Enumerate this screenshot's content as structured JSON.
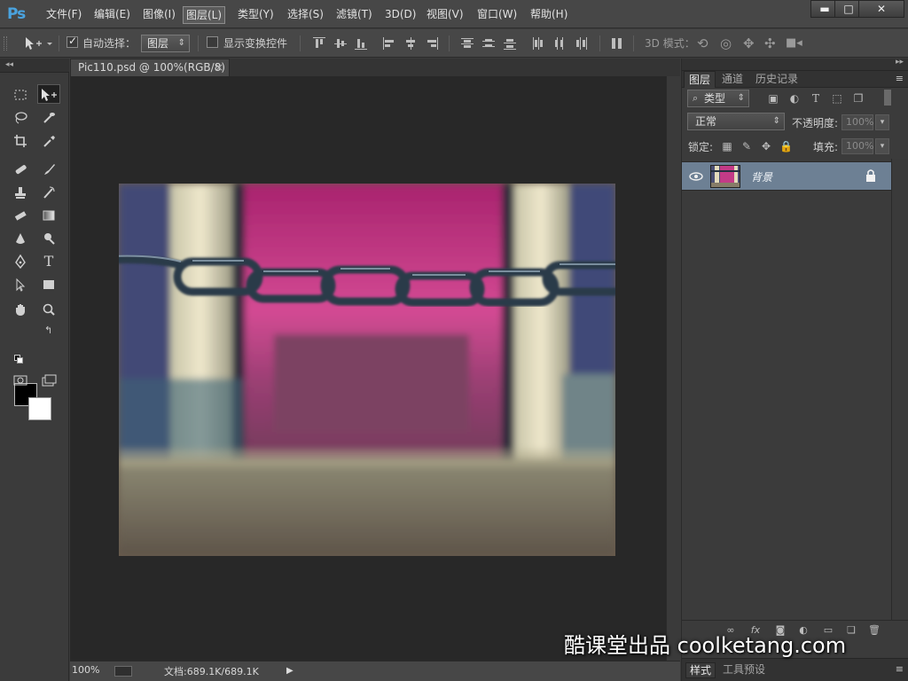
{
  "app": {
    "logo": "Ps"
  },
  "menu": {
    "items": [
      "文件(F)",
      "编辑(E)",
      "图像(I)",
      "图层(L)",
      "类型(Y)",
      "选择(S)",
      "滤镜(T)",
      "3D(D)",
      "视图(V)",
      "窗口(W)",
      "帮助(H)"
    ],
    "active": "图层(L)"
  },
  "window_controls": {
    "minimize": "▬",
    "maximize": "□",
    "close": "✕"
  },
  "options": {
    "auto_select_label": "自动选择：",
    "auto_select_checked": true,
    "target_dropdown": "图层",
    "show_transform_label": "显示变换控件",
    "show_transform_checked": false,
    "mode_3d_label": "3D 模式："
  },
  "document": {
    "tab_title": "Pic110.psd @ 100%(RGB/8)",
    "tab_close": "×",
    "zoom": "100%",
    "doc_size": "文档:689.1K/689.1K"
  },
  "panels": {
    "tabs": [
      "图层",
      "通道",
      "历史记录"
    ],
    "active_tab": "图层",
    "filter_kind": "类型",
    "blend_mode": "正常",
    "opacity_label": "不透明度:",
    "opacity_value": "100%",
    "lock_label": "锁定:",
    "fill_label": "填充:",
    "fill_value": "100%",
    "layers": [
      {
        "name": "背景",
        "visible": true,
        "locked": true
      }
    ],
    "bottom_tabs": [
      "样式",
      "工具预设"
    ],
    "bottom_active": "样式"
  },
  "watermark": "酷课堂出品 coolketang.com",
  "colors": {
    "foreground": "#000000",
    "background": "#ffffff",
    "selected_layer": "#6d8094",
    "accent_logo": "#4aa3df"
  }
}
